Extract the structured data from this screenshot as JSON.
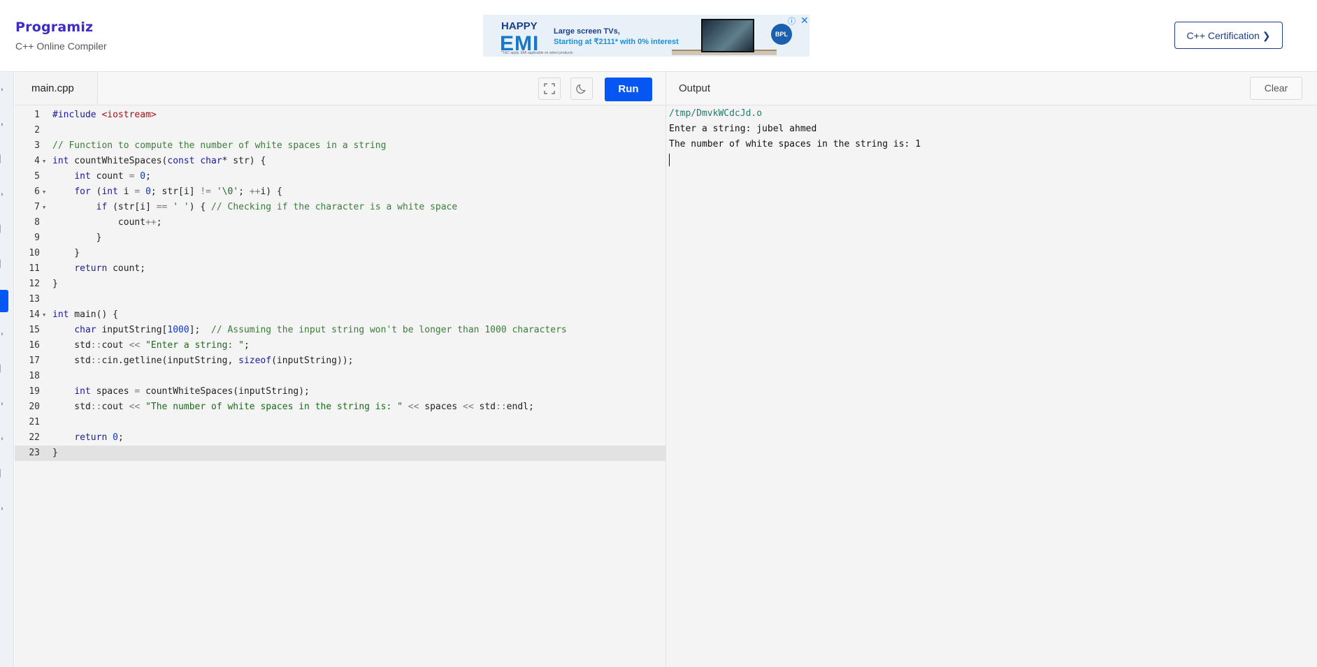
{
  "header": {
    "logo_text": "Programiz",
    "subtitle": "C++ Online Compiler",
    "cert_button": "C++ Certification ❯"
  },
  "ad": {
    "happy": "HAPPY",
    "emi": "EMI",
    "line1": "Large screen TVs,",
    "line2": "Starting at ₹2111* with 0% interest",
    "brand": "BPL",
    "fineprint": "*T&C apply. EMI applicable on select products",
    "close_icon": "close-icon",
    "info_icon": "info-icon"
  },
  "editor": {
    "tab_label": "main.cpp",
    "run_label": "Run",
    "fullscreen_icon": "fullscreen-icon",
    "theme_icon": "moon-icon",
    "active_line": 23,
    "lines": [
      {
        "n": "1",
        "fold": false,
        "code": "#include <iostream>"
      },
      {
        "n": "2",
        "fold": false,
        "code": ""
      },
      {
        "n": "3",
        "fold": false,
        "code": "// Function to compute the number of white spaces in a string"
      },
      {
        "n": "4",
        "fold": true,
        "code": "int countWhiteSpaces(const char* str) {"
      },
      {
        "n": "5",
        "fold": false,
        "code": "    int count = 0;"
      },
      {
        "n": "6",
        "fold": true,
        "code": "    for (int i = 0; str[i] != '\\0'; ++i) {"
      },
      {
        "n": "7",
        "fold": true,
        "code": "        if (str[i] == ' ') { // Checking if the character is a white space"
      },
      {
        "n": "8",
        "fold": false,
        "code": "            count++;"
      },
      {
        "n": "9",
        "fold": false,
        "code": "        }"
      },
      {
        "n": "10",
        "fold": false,
        "code": "    }"
      },
      {
        "n": "11",
        "fold": false,
        "code": "    return count;"
      },
      {
        "n": "12",
        "fold": false,
        "code": "}"
      },
      {
        "n": "13",
        "fold": false,
        "code": ""
      },
      {
        "n": "14",
        "fold": true,
        "code": "int main() {"
      },
      {
        "n": "15",
        "fold": false,
        "code": "    char inputString[1000];  // Assuming the input string won't be longer than 1000 characters"
      },
      {
        "n": "16",
        "fold": false,
        "code": "    std::cout << \"Enter a string: \";"
      },
      {
        "n": "17",
        "fold": false,
        "code": "    std::cin.getline(inputString, sizeof(inputString));"
      },
      {
        "n": "18",
        "fold": false,
        "code": ""
      },
      {
        "n": "19",
        "fold": false,
        "code": "    int spaces = countWhiteSpaces(inputString);"
      },
      {
        "n": "20",
        "fold": false,
        "code": "    std::cout << \"The number of white spaces in the string is: \" << spaces << std::endl;"
      },
      {
        "n": "21",
        "fold": false,
        "code": ""
      },
      {
        "n": "22",
        "fold": false,
        "code": "    return 0;"
      },
      {
        "n": "23",
        "fold": false,
        "code": "}"
      }
    ]
  },
  "output": {
    "title": "Output",
    "clear_label": "Clear",
    "path": "/tmp/DmvkWCdcJd.o",
    "lines": [
      "Enter a string: jubel ahmed",
      "The number of white spaces in the string is: 1"
    ]
  },
  "colors": {
    "brand": "#3d2bc8",
    "run": "#0556f3",
    "keyword": "#1b1ba0",
    "string": "#1a6b1a",
    "comment": "#3b7b3b"
  }
}
